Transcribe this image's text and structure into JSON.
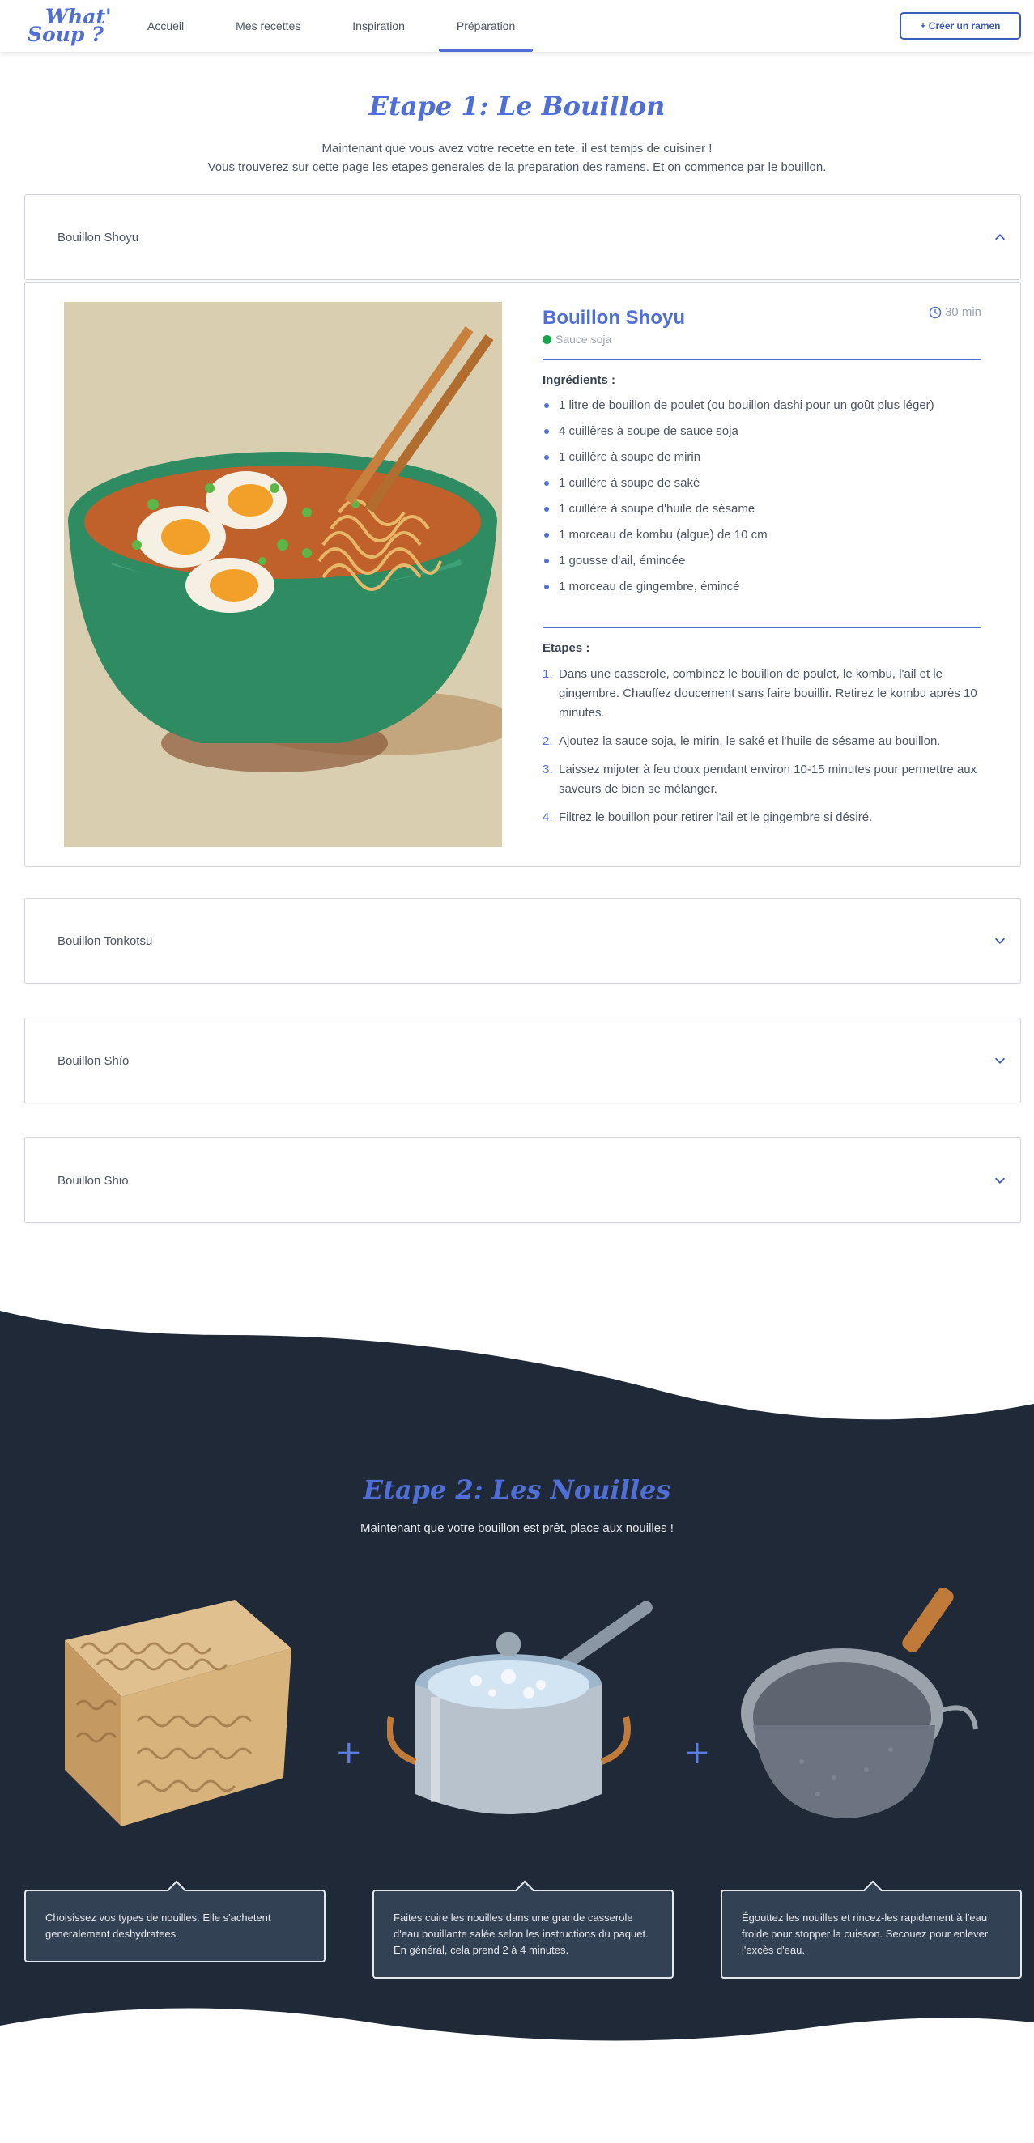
{
  "nav": {
    "logo_line1": "What'",
    "logo_line2": "Soup ?",
    "links": [
      "Accueil",
      "Mes recettes",
      "Inspiration",
      "Préparation"
    ],
    "active": "Préparation",
    "create_button": "+ Créer un ramen"
  },
  "step1": {
    "title": "Etape 1: Le Bouillon",
    "intro_line1": "Maintenant que vous avez votre recette en tete, il est temps de cuisiner !",
    "intro_line2": "Vous trouverez sur cette page les etapes generales de la preparation des ramens. Et on commence par le bouillon.",
    "accordion": [
      {
        "label": "Bouillon Shoyu",
        "expanded": true,
        "icon": "chevron-up-icon"
      },
      {
        "label": "Bouillon Tonkotsu",
        "expanded": false,
        "icon": "chevron-down-icon"
      },
      {
        "label": "Bouillon Shío",
        "expanded": false,
        "icon": "chevron-down-icon"
      },
      {
        "label": "Bouillon Shio",
        "expanded": false,
        "icon": "chevron-down-icon"
      }
    ],
    "recipe": {
      "title": "Bouillon Shoyu",
      "time": "30 min",
      "tag": "Sauce soja",
      "tag_color": "#16a34a",
      "ingredients_heading": "Ingrédients :",
      "ingredients": [
        "1 litre de bouillon de poulet (ou bouillon dashi pour un goût plus léger)",
        "4 cuillères à soupe de sauce soja",
        "1 cuillère à soupe de mirin",
        "1 cuillère à soupe de saké",
        "1 cuillère à soupe d'huile de sésame",
        "1 morceau de kombu (algue) de 10 cm",
        "1 gousse d'ail, émincée",
        "1 morceau de gingembre, émincé"
      ],
      "steps_heading": "Etapes :",
      "steps": [
        {
          "num": "1.",
          "text": "Dans une casserole, combinez le bouillon de poulet, le kombu, l'ail et le gingembre. Chauffez doucement sans faire bouillir. Retirez le kombu après 10 minutes."
        },
        {
          "num": "2.",
          "text": "Ajoutez la sauce soja, le mirin, le saké et l'huile de sésame au bouillon."
        },
        {
          "num": "3.",
          "text": "Laissez mijoter à feu doux pendant environ 10-15 minutes pour permettre aux saveurs de bien se mélanger."
        },
        {
          "num": "4.",
          "text": "Filtrez le bouillon pour retirer l'ail et le gingembre si désiré."
        }
      ]
    }
  },
  "step2": {
    "title": "Etape 2: Les Nouilles",
    "intro": "Maintenant que votre bouillon est prêt, place aux nouilles !",
    "plus": "+",
    "cards": [
      "Choisissez vos types de nouilles. Elle s'achetent generalement deshydratees.",
      "Faites cuire les nouilles dans une grande casserole d'eau bouillante salée selon les instructions du paquet. En général, cela prend 2 à 4 minutes.",
      "Égouttez les nouilles et rincez-les rapidement à l'eau froide pour stopper la cuisson. Secouez pour enlever l'excès d'eau."
    ]
  },
  "colors": {
    "accent": "#4f6fd6",
    "dark_bg": "#1f2937",
    "card_bg": "#334155"
  }
}
